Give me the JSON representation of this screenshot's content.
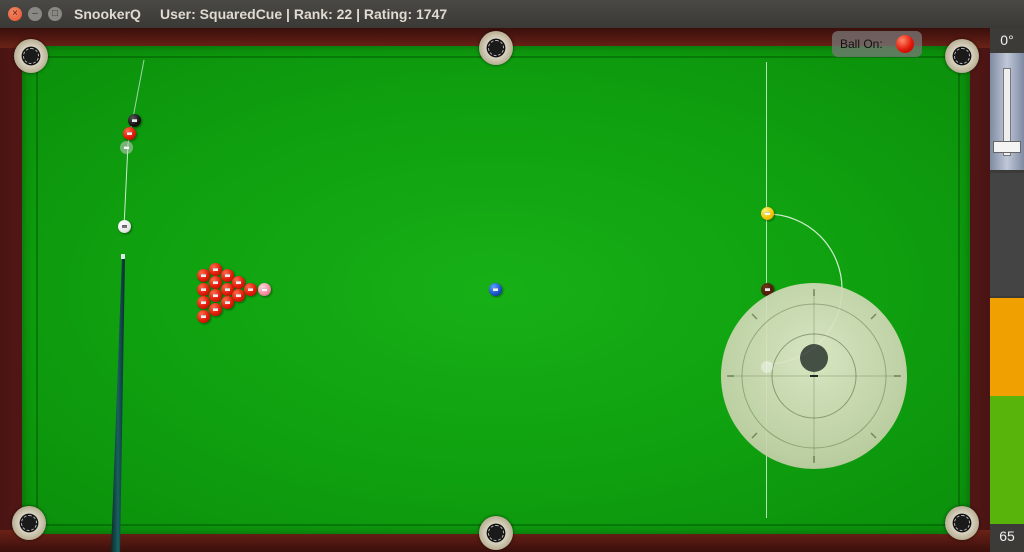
{
  "window": {
    "app_name": "SnookerQ",
    "user_info": "User: SquaredCue | Rank: 22 | Rating: 1747",
    "close_glyph": "×",
    "minimize_glyph": "–",
    "maximize_glyph": "□"
  },
  "hud": {
    "ball_on_label": "Ball On:",
    "ball_on_color": "#e21a0a"
  },
  "power_panel": {
    "angle_label": "0°",
    "power_label": "65",
    "power_level_percent": 65
  },
  "colors": {
    "felt": "#10a010",
    "rail": "#5a1a14",
    "red_ball": "#e21a0a",
    "yellow_ball": "#f2c400",
    "blue_ball": "#1a52c8",
    "pink_ball": "#f48aa0",
    "brown_ball": "#4a1e08",
    "black_ball": "#111111",
    "cue_ball": "#ffffff"
  },
  "balls": {
    "red_count": 16,
    "colors_on_table": [
      "black",
      "yellow",
      "brown",
      "blue",
      "pink",
      "white"
    ]
  }
}
